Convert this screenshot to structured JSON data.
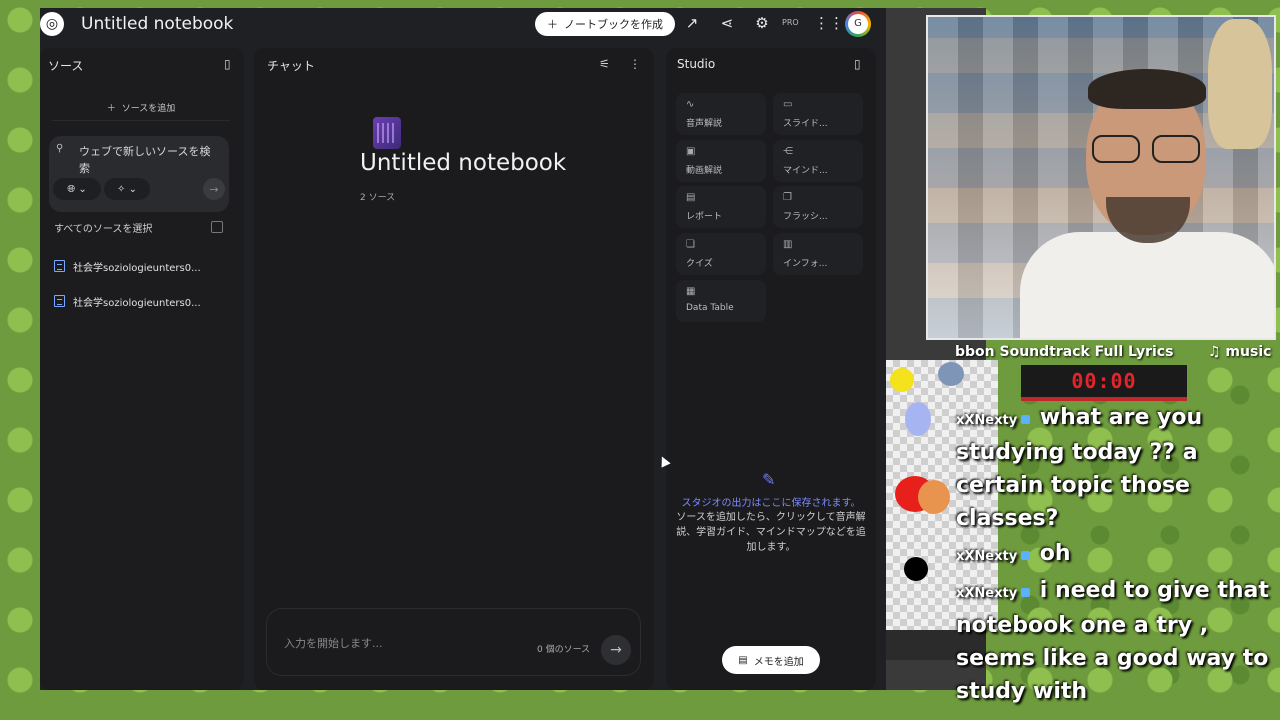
{
  "app": {
    "title": "Untitled notebook",
    "create_button": "ノートブックを作成",
    "pro_label": "PRO"
  },
  "sources": {
    "title": "ソース",
    "add_label": "ソースを追加",
    "search_text": "ウェブで新しいソースを検索",
    "select_all": "すべてのソースを選択",
    "items": [
      {
        "label": "社会学soziologieunters0..."
      },
      {
        "label": "社会学soziologieunters0..."
      }
    ]
  },
  "chat": {
    "title": "チャット",
    "notebook_title": "Untitled notebook",
    "source_count": "2 ソース",
    "input_placeholder": "入力を開始します...",
    "input_source_count": "0 個のソース"
  },
  "studio": {
    "title": "Studio",
    "tiles": [
      {
        "label": "音声解説",
        "icon": "waveform-icon"
      },
      {
        "label": "スライド...",
        "icon": "slides-icon"
      },
      {
        "label": "動画解説",
        "icon": "video-icon"
      },
      {
        "label": "マインド...",
        "icon": "mindmap-icon"
      },
      {
        "label": "レポート",
        "icon": "report-icon"
      },
      {
        "label": "フラッシ...",
        "icon": "flashcards-icon"
      },
      {
        "label": "クイズ",
        "icon": "quiz-icon"
      },
      {
        "label": "インフォ...",
        "icon": "infographic-icon"
      },
      {
        "label": "Data Table",
        "icon": "table-icon"
      }
    ],
    "note_highlight": "スタジオの出力はここに保存されます。",
    "note_body": "ソースを追加したら、クリックして音声解説、学習ガイド、マインドマップなどを追加します。",
    "memo_button": "メモを追加"
  },
  "stream": {
    "now_playing": "bbon  Soundtrack Full Lyrics",
    "music_label": "♫ music",
    "timer": "00:00",
    "chat": [
      {
        "user": "xXNexty",
        "text": "what are you studying today ?? a certain topic those classes?"
      },
      {
        "user": "xXNexty",
        "text": "oh"
      },
      {
        "user": "xXNexty",
        "text": "i need to give that notebook one a try , seems like a good way to study with"
      }
    ]
  },
  "colors": {
    "accent_blue": "#7a8cff",
    "panel_bg": "#1b1b1e",
    "app_bg": "#1f2023"
  }
}
